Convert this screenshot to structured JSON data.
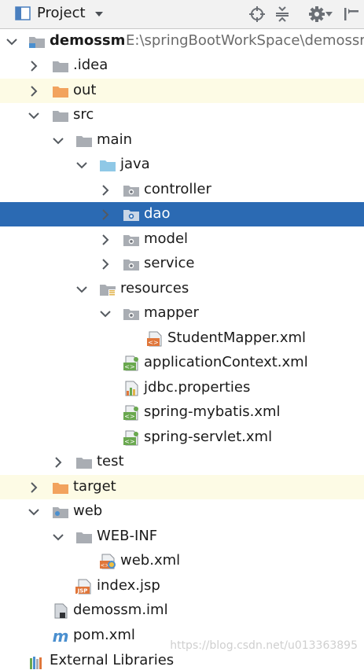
{
  "toolbar": {
    "title": "Project",
    "icons": [
      "project-view-icon",
      "dropdown-caret-icon",
      "locate-target-icon",
      "collapse-all-icon",
      "gear-icon",
      "hide-panel-icon"
    ]
  },
  "tree": {
    "root": {
      "name": "demossm",
      "path": "E:\\springBootWorkSpace\\demossm"
    },
    "idea": ".idea",
    "out": "out",
    "src": "src",
    "main": "main",
    "java": "java",
    "controller": "controller",
    "dao": "dao",
    "model": "model",
    "service": "service",
    "resources": "resources",
    "mapper": "mapper",
    "student_mapper": "StudentMapper.xml",
    "app_context": "applicationContext.xml",
    "jdbc": "jdbc.properties",
    "spring_mybatis": "spring-mybatis.xml",
    "spring_servlet": "spring-servlet.xml",
    "test": "test",
    "target": "target",
    "web": "web",
    "web_inf": "WEB-INF",
    "web_xml": "web.xml",
    "index_jsp": "index.jsp",
    "iml": "demossm.iml",
    "pom": "pom.xml",
    "external": "External Libraries"
  },
  "colors": {
    "selection": "#2b6ab3",
    "excluded_bg": "#fdfbe5",
    "excluded_folder": "#f2a35e",
    "folder": "#a9adb3",
    "source_folder": "#8fc8e6",
    "module_dot": "#4a8fcf"
  },
  "watermark": "https://blog.csdn.net/u013363895"
}
